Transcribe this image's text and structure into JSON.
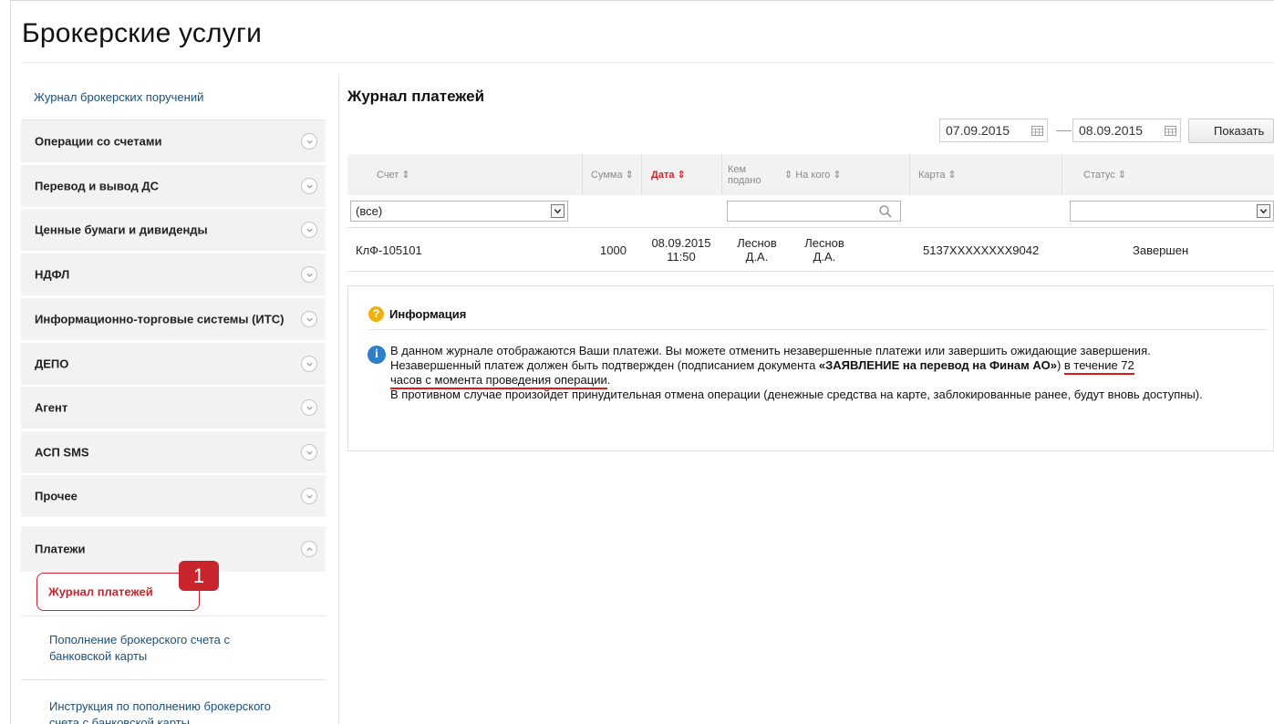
{
  "page": {
    "title": "Брокерские услуги"
  },
  "sidebar": {
    "top_link": "Журнал брокерских поручений",
    "sections": [
      {
        "label": "Операции со счетами",
        "state": "collapsed"
      },
      {
        "label": "Перевод и вывод ДС",
        "state": "collapsed"
      },
      {
        "label": "Ценные бумаги и дивиденды",
        "state": "collapsed"
      },
      {
        "label": "НДФЛ",
        "state": "collapsed"
      },
      {
        "label": "Информационно-торговые системы (ИТС)",
        "state": "collapsed"
      },
      {
        "label": "ДЕПО",
        "state": "collapsed"
      },
      {
        "label": "Агент",
        "state": "collapsed"
      },
      {
        "label": "АСП SMS",
        "state": "collapsed"
      },
      {
        "label": "Прочее",
        "state": "collapsed"
      },
      {
        "label": "Платежи",
        "state": "expanded"
      }
    ],
    "sub_items": [
      {
        "label": "Журнал платежей",
        "active": true
      },
      {
        "label": "Пополнение брокерского счета с банковской карты",
        "active": false
      },
      {
        "label": "Инструкция по пополнению брокерского счета с банковской карты",
        "active": false
      }
    ],
    "callout_number": "1"
  },
  "main": {
    "title": "Журнал платежей",
    "date_from": "07.09.2015",
    "date_to": "08.09.2015",
    "show_button": "Показать",
    "table": {
      "headers": [
        {
          "label": "Счет ⇕"
        },
        {
          "label": "Сумма ⇕"
        },
        {
          "label": "Дата ⇕"
        },
        {
          "label": "Кем подано"
        },
        {
          "label": "⇕ На кого ⇕"
        },
        {
          "label": "Карта ⇕"
        },
        {
          "label": "Статус ⇕"
        }
      ],
      "filters": {
        "account": "(все)",
        "submitted_by": "",
        "status": ""
      },
      "rows": [
        {
          "account": "КлФ-105101",
          "amount": "1000",
          "date": "08.09.2015",
          "time": "11:50",
          "submitted_by_line1": "Леснов",
          "submitted_by_line2": "Д.А.",
          "recipient_line1": "Леснов",
          "recipient_line2": "Д.А.",
          "card": "5137XXXXXXXX9042",
          "status": "Завершен"
        }
      ]
    },
    "info": {
      "title": "Информация",
      "line1": "В данном журнале отображаются Ваши платежи. Вы можете отменить незавершенные платежи или завершить ожидающие завершения.",
      "line2_a": "Незавершенный платеж должен быть подтвержден (подписанием документа ",
      "line2_bold": "«ЗАЯВЛЕНИЕ на перевод на Финам АО»",
      "line2_b": ") ",
      "line2_ul": "в течение 72",
      "line3_ul": "часов с момента проведения операции",
      "line3_end": ".",
      "line4": "В противном случае произойдет принудительная отмена операции (денежные средства на карте, заблокированные ранее, будут вновь доступны)."
    }
  },
  "colors": {
    "accent_red": "#c9252c",
    "link_blue": "#1a4f7a",
    "underline_red": "#e2161b",
    "info_blue": "#2f7fc8",
    "warn_yellow": "#f2b10a"
  },
  "icons": {
    "expand": "chevron-down-icon",
    "collapse": "chevron-up-icon",
    "calendar": "calendar-icon",
    "search": "search-icon",
    "question": "question-icon",
    "info": "info-icon"
  }
}
